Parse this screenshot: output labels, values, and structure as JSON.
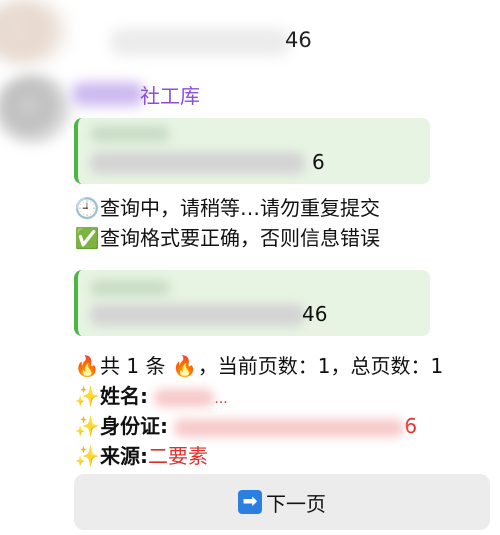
{
  "top_message": {
    "visible_tail": "46"
  },
  "bot": {
    "name_visible": "社工库"
  },
  "quote1": {
    "tail": "6"
  },
  "status_lines": {
    "querying_emoji": "🕘",
    "querying": "查询中，请稍等…请勿重复提交",
    "format_emoji": "✅",
    "format": "查询格式要正确，否则信息错误"
  },
  "quote2": {
    "tail": "46"
  },
  "result": {
    "summary_emoji": "🔥",
    "summary_part1": "共 1 条",
    "summary_part2": "，当前页数：1，总页数：1",
    "sparkle_emoji": "✨",
    "name_label": "姓名:",
    "name_tail": "...",
    "id_label": "身份证:",
    "id_tail": "6",
    "source_label": "来源:",
    "source_value": "二要素"
  },
  "next_button": {
    "arrow": "➡",
    "label": "下一页"
  },
  "colors": {
    "accent_green": "#4fb446",
    "quote_bg": "#e7f4e3",
    "sender_purple": "#8a4fd8",
    "highlight_red": "#e0302c",
    "button_bg": "#ececec"
  }
}
